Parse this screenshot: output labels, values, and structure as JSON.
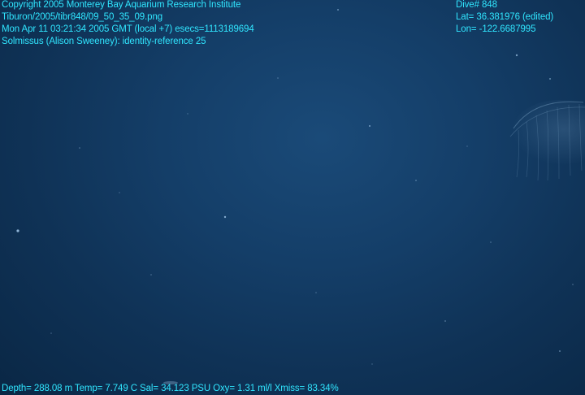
{
  "overlay": {
    "top_left": [
      "Copyright 2005 Monterey Bay Aquarium Research Institute",
      "Tiburon/2005/tibr848/09_50_35_09.png",
      "Mon Apr 11 03:21:34 2005 GMT (local +7)  esecs=1113189694",
      "Solmissus (Alison Sweeney): identity-reference 25"
    ],
    "top_right": [
      "Dive# 848",
      "Lat= 36.381976 (edited)",
      "Lon= -122.6687995"
    ],
    "bottom_left": "Depth= 288.08 m  Temp= 7.749 C  Sal= 34.123 PSU  Oxy= 1.31 ml/l  Xmiss= 83.34%"
  },
  "colors": {
    "overlay_text": "#30e6ff",
    "water_deep": "#0a2745",
    "water_mid": "#143e68"
  }
}
